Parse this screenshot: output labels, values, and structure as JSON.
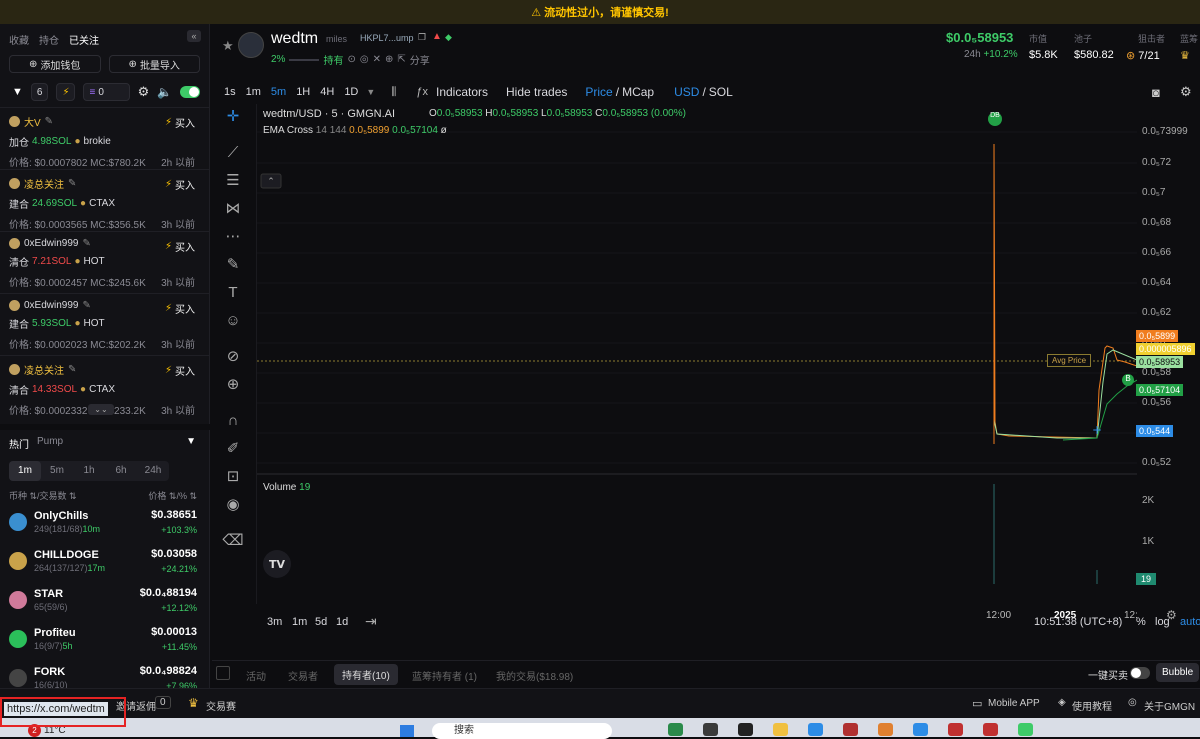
{
  "warning": "⚠ 流动性过小，请谨慎交易!",
  "left": {
    "tabs": [
      "收藏",
      "持仓",
      "已关注"
    ],
    "add_wallet": "添加钱包",
    "batch_import": "批量导入",
    "filter_count": "6",
    "zero_count": "0",
    "feed": [
      {
        "name": "大V",
        "buy": "买入",
        "action": "加仓",
        "amount": "4.98SOL",
        "token": "brokie",
        "price": "价格: $0.0007802 MC:$780.2K",
        "time": "2h 以前",
        "amount_color": "green"
      },
      {
        "name": "凌总关注",
        "buy": "买入",
        "action": "建合",
        "amount": "24.69SOL",
        "token": "CTAX",
        "price": "价格: $0.0003565 MC:$356.5K",
        "time": "3h 以前",
        "amount_color": "green"
      },
      {
        "name": "0xEdwin999",
        "buy": "买入",
        "action": "清仓",
        "amount": "7.21SOL",
        "token": "HOT",
        "price": "价格: $0.0002457 MC:$245.6K",
        "time": "3h 以前",
        "amount_color": "red"
      },
      {
        "name": "0xEdwin999",
        "buy": "买入",
        "action": "建合",
        "amount": "5.93SOL",
        "token": "HOT",
        "price": "价格: $0.0002023 MC:$202.2K",
        "time": "3h 以前",
        "amount_color": "green"
      },
      {
        "name": "凌总关注",
        "buy": "买入",
        "action": "清合",
        "amount": "14.33SOL",
        "token": "CTAX",
        "price": "价格: $0.0002332 MC:$233.2K",
        "time": "3h 以前",
        "amount_color": "red"
      }
    ],
    "hot_tabs": [
      "热门",
      "Pump"
    ],
    "time_tabs": [
      "1m",
      "5m",
      "1h",
      "6h",
      "24h"
    ],
    "col_left": "币种 ⇅/交易数 ⇅",
    "col_right": "价格 ⇅/% ⇅",
    "coins": [
      {
        "name": "OnlyChills",
        "sub": "249(181/68)",
        "sub2": "10m",
        "price": "$0.38651",
        "chg": "+103.3%",
        "color": "#3a8fd0"
      },
      {
        "name": "CHILLDOGE",
        "sub": "264(137/127)",
        "sub2": "17m",
        "price": "$0.03058",
        "chg": "+24.21%",
        "color": "#c9a24a"
      },
      {
        "name": "STAR",
        "sub": "65(59/6)",
        "sub2": "",
        "price": "$0.0₄88194",
        "chg": "+12.12%",
        "color": "#d07a9a"
      },
      {
        "name": "Profiteu",
        "sub": "16(9/7)",
        "sub2": "5h",
        "price": "$0.00013",
        "chg": "+11.45%",
        "color": "#2bbf5a"
      },
      {
        "name": "FORK",
        "sub": "16(6/10)",
        "sub2": "",
        "price": "$0.0₄98824",
        "chg": "+7.96%",
        "color": "#444"
      }
    ]
  },
  "header": {
    "name": "wedtm",
    "sub": "miles",
    "address": "HKPL7...ump",
    "pct": "2%",
    "holding": "持有",
    "share": "分享",
    "price": "$0.0₅58953",
    "h24_label": "24h",
    "h24": "+10.2%",
    "stats": [
      {
        "label": "市值",
        "value": "$5.8K"
      },
      {
        "label": "池子",
        "value": "$580.82"
      },
      {
        "label": "狙击者",
        "value": "7/21"
      },
      {
        "label": "蓝筹",
        "value": ""
      }
    ]
  },
  "toolbar": {
    "intervals": [
      "1s",
      "1m",
      "5m",
      "1H",
      "4H",
      "1D"
    ],
    "active_interval": "5m",
    "indicators": "Indicators",
    "hide_trades": "Hide trades",
    "price": "Price",
    "mcap": "MCap",
    "usd": "USD",
    "sol": "SOL"
  },
  "chart_data": {
    "type": "line",
    "title": "wedtm/USD · 5 · GMGN.AI",
    "ohlc": {
      "O": "0.0₅58953",
      "H": "0.0₅58953",
      "L": "0.0₅58953",
      "C": "0.0₅58953",
      "chg": "(0.00%)"
    },
    "indicator": {
      "name": "EMA Cross",
      "params": "14 144",
      "v1": "0.0₅5899",
      "v2": "0.0₅57104",
      "tail": "ø"
    },
    "y_ticks": [
      "0.0₅73999",
      "0.0₅72",
      "0.0₅7",
      "0.0₅68",
      "0.0₅66",
      "0.0₅64",
      "0.0₅62",
      "0.0₅6",
      "0.0₅58",
      "0.0₅56",
      "0.0₅54",
      "0.0₅52"
    ],
    "y_labels": [
      {
        "text": "0.0₅5899",
        "color": "#f07d1e"
      },
      {
        "text": "0.000005896",
        "color": "#f0d030"
      },
      {
        "text": "0.0₅58953",
        "color": "#9be0a0"
      },
      {
        "text": "0.0₅57104",
        "color": "#22a046"
      },
      {
        "text": "0.0₅544",
        "color": "#2d8ce6"
      }
    ],
    "x_ticks": [
      "12:00",
      "2025",
      "12:"
    ],
    "avg_price_label": "Avg Price",
    "markers": [
      "DB",
      "B"
    ],
    "volume_label": "Volume",
    "volume_value": "19",
    "volume_ticks": [
      "2K",
      "1K"
    ],
    "volume_last": "19",
    "ylim": [
      5.2e-06,
      7.4e-06
    ]
  },
  "range_bar": {
    "ranges": [
      "3m",
      "1m",
      "5d",
      "1d"
    ],
    "clock": "10:51:38 (UTC+8)",
    "pct": "%",
    "log": "log",
    "auto": "auto"
  },
  "bottom_tabs": [
    "活动",
    "交易者",
    "持有者(10)",
    "蓝筹持有者 (1)",
    "我的交易($18.98)"
  ],
  "quick_buy": "一键买卖",
  "bubble": "Bubble",
  "statusbar": {
    "invite": "邀请返佣",
    "invite_count": "0",
    "contest": "交易赛",
    "mobile": "Mobile APP",
    "tutorial": "使用教程",
    "about": "关于GMGN"
  },
  "url_tip": "https://x.com/wedtm",
  "taskbar": {
    "badge": "2",
    "temp": "11°C",
    "search": "搜索"
  }
}
